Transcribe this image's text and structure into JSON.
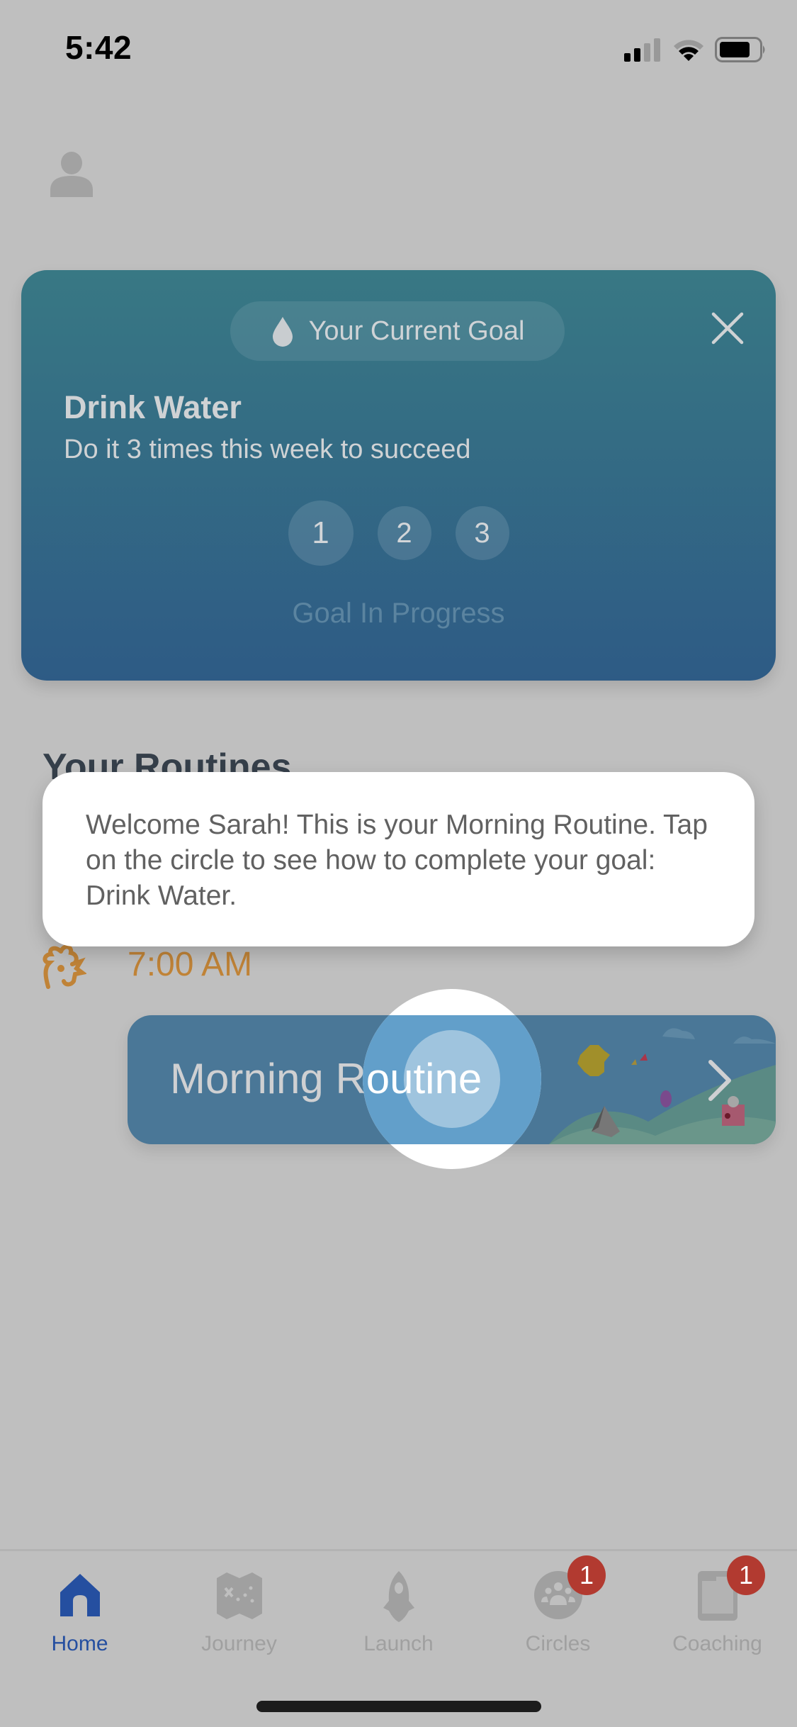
{
  "status_bar": {
    "time": "5:42",
    "icons": [
      "signal-icon",
      "wifi-icon",
      "battery-icon"
    ]
  },
  "header": {
    "profile_icon": "person-icon"
  },
  "goal_card": {
    "pill_icon": "water-drop-icon",
    "pill_label": "Your Current Goal",
    "close_icon": "close-icon",
    "title": "Drink Water",
    "subtitle": "Do it 3 times this week to succeed",
    "steps": [
      "1",
      "2",
      "3"
    ],
    "completed_steps": 0,
    "total_steps": 3,
    "status": "Goal In Progress"
  },
  "routines": {
    "section_title": "Your Routines",
    "items": [
      {
        "icon": "rooster-icon",
        "time": "7:00 AM",
        "name": "Morning Routine",
        "chevron_icon": "chevron-right-icon"
      }
    ]
  },
  "tooltip": {
    "text": "Welcome Sarah! This is your Morning Routine. Tap on the circle to see how to complete your goal: Drink Water."
  },
  "tab_bar": {
    "active": "Home",
    "tabs": [
      {
        "label": "Home",
        "icon": "home-icon",
        "badge": null
      },
      {
        "label": "Journey",
        "icon": "map-icon",
        "badge": null
      },
      {
        "label": "Launch",
        "icon": "rocket-icon",
        "badge": null
      },
      {
        "label": "Circles",
        "icon": "group-icon",
        "badge": "1"
      },
      {
        "label": "Coaching",
        "icon": "phone-icon",
        "badge": "1"
      }
    ]
  },
  "colors": {
    "overlay_bg": "#bfbfbf",
    "goal_card_top": "#387884",
    "goal_card_bottom": "#2e5b85",
    "routine_time": "#c08337",
    "tab_active": "#254fa0",
    "tab_inactive": "#a0a0a0",
    "badge": "#b23a30"
  }
}
